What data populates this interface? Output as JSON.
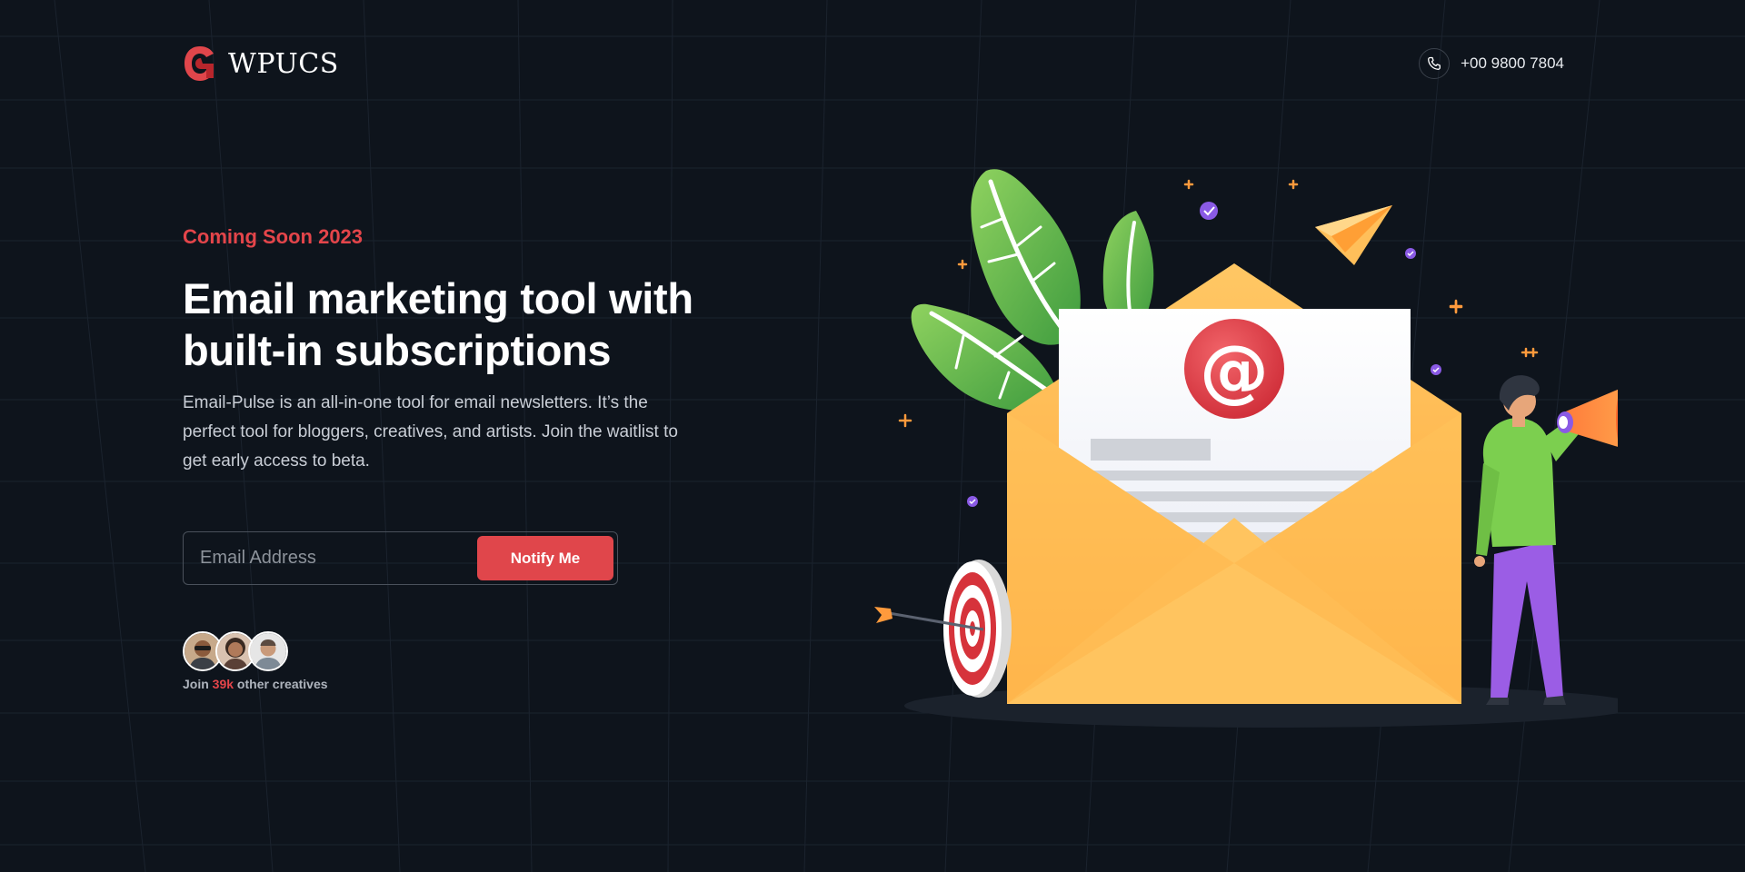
{
  "brand": {
    "name": "WPUCS",
    "accent": "#e4454a"
  },
  "header": {
    "phone": "+00 9800 7804",
    "phone_icon": "phone-icon"
  },
  "hero": {
    "eyebrow": "Coming Soon 2023",
    "title_line1": "Email marketing tool with",
    "title_line2": "built-in subscriptions",
    "description": "Email-Pulse is an all-in-one tool for email newsletters. It’s the perfect tool for bloggers, creatives, and artists. Join the waitlist to get early access to beta."
  },
  "form": {
    "email_placeholder": "Email Address",
    "email_value": "",
    "submit_label": "Notify Me"
  },
  "social_proof": {
    "prefix": "Join",
    "count": "39k",
    "suffix": "other creatives",
    "avatar_count": 3
  },
  "illustration": {
    "name": "email-envelope-illustration",
    "elements": [
      "envelope-icon",
      "at-sign-icon",
      "paper-plane-icon",
      "target-icon",
      "megaphone-icon",
      "person-figure",
      "leaf-icon"
    ]
  },
  "colors": {
    "background": "#0e141c",
    "button": "#e0464b",
    "envelope": "#ffb84d"
  }
}
